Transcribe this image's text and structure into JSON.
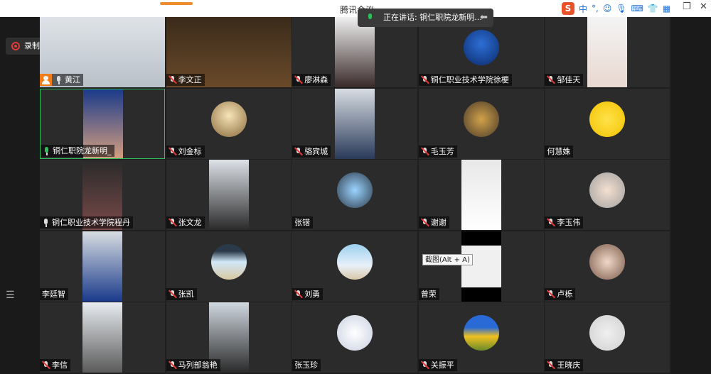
{
  "window": {
    "title": "腾讯会议",
    "ime_mode": "中",
    "ime_punct": "°,",
    "ime_icons": [
      "smile-icon",
      "mic-icon",
      "keyboard-icon",
      "shirt-icon",
      "grid-icon"
    ]
  },
  "recording": {
    "label": "录制中"
  },
  "speaker": {
    "label": "正在讲话: 铜仁职院龙新明..."
  },
  "tooltip": {
    "label": "截图(Alt + A)"
  },
  "colors": {
    "host_badge": "#f07d1a",
    "speaking": "#2fbf5a",
    "muted": "#e23a3a"
  },
  "participants": [
    {
      "name": "黄江",
      "mic": "on",
      "host": true,
      "display": "video"
    },
    {
      "name": "李文正",
      "mic": "muted",
      "display": "video"
    },
    {
      "name": "廖淋森",
      "mic": "muted",
      "display": "video"
    },
    {
      "name": "铜仁职业技术学院徐梗",
      "mic": "muted",
      "display": "avatar",
      "avatar": "tennis-player"
    },
    {
      "name": "邹佳天",
      "mic": "muted",
      "display": "video"
    },
    {
      "name": "铜仁职院龙新明_",
      "mic": "active",
      "display": "video",
      "speaking": true
    },
    {
      "name": "刘金标",
      "mic": "muted",
      "display": "avatar",
      "avatar": "anime-boy"
    },
    {
      "name": "骆宾城",
      "mic": "muted",
      "display": "video"
    },
    {
      "name": "毛玉芳",
      "mic": "muted",
      "display": "avatar",
      "avatar": "toy-figure"
    },
    {
      "name": "何慧姝",
      "mic": "none",
      "display": "avatar",
      "avatar": "cartoon-chick"
    },
    {
      "name": "铜仁职业技术学院程丹",
      "mic": "on",
      "display": "video"
    },
    {
      "name": "张文龙",
      "mic": "muted",
      "display": "video"
    },
    {
      "name": "张锴",
      "mic": "none",
      "display": "avatar",
      "avatar": "cartoon-boy"
    },
    {
      "name": "谢谢",
      "mic": "muted",
      "display": "video"
    },
    {
      "name": "李玉伟",
      "mic": "muted",
      "display": "avatar",
      "avatar": "baby"
    },
    {
      "name": "李廷智",
      "mic": "none",
      "display": "video"
    },
    {
      "name": "张凯",
      "mic": "muted",
      "display": "avatar",
      "avatar": "beach-palm"
    },
    {
      "name": "刘勇",
      "mic": "muted",
      "display": "avatar",
      "avatar": "beach-people"
    },
    {
      "name": "曾荣",
      "mic": "none",
      "display": "video"
    },
    {
      "name": "卢栎",
      "mic": "muted",
      "display": "avatar",
      "avatar": "hand-photo"
    },
    {
      "name": "李信",
      "mic": "muted",
      "display": "video"
    },
    {
      "name": "马列部翁艳",
      "mic": "muted",
      "display": "video"
    },
    {
      "name": "张玉珍",
      "mic": "none",
      "display": "avatar",
      "avatar": "anime-girl"
    },
    {
      "name": "关振平",
      "mic": "muted",
      "display": "avatar",
      "avatar": "sunflowers"
    },
    {
      "name": "王晓庆",
      "mic": "muted",
      "display": "avatar",
      "avatar": "red-hat-girl"
    }
  ]
}
